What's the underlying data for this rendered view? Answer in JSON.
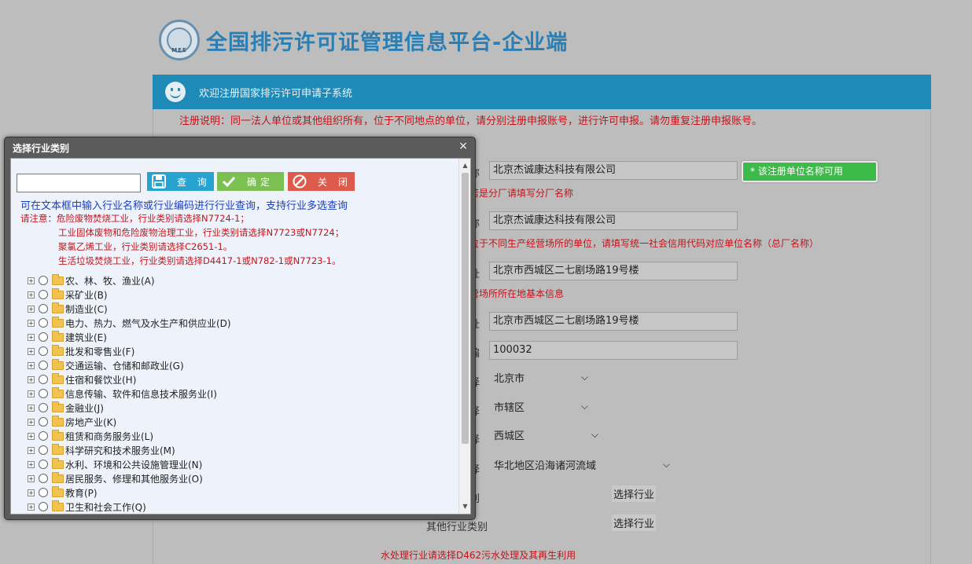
{
  "header": {
    "title": "全国排污许可证管理信息平台-企业端",
    "logo_text": "MEE"
  },
  "banner": {
    "text": "欢迎注册国家排污许可申请子系统"
  },
  "registration_note": "注册说明：同一法人单位或其他组织所有，位于不同地点的单位，请分别注册申报账号，进行许可申报。请勿重复注册申报账号。",
  "form": {
    "unit_name": {
      "label_tail": "称",
      "value": "北京杰诚康达科技有限公司",
      "hint": "若是分厂请填写分厂名称",
      "badge": "* 该注册单位名称可用"
    },
    "parent_name": {
      "label_tail": "称",
      "value": "北京杰诚康达科技有限公司",
      "hint": "位于不同生产经营场所的单位，请填写统一社会信用代码对应单位名称（总厂名称）"
    },
    "site_address": {
      "label_tail": "址",
      "value": "北京市西城区二七剧场路19号楼",
      "hint": "营场所所在地基本信息"
    },
    "office_address": {
      "label_tail": "址",
      "value": "北京市西城区二七剧场路19号楼"
    },
    "postcode": {
      "label_tail": "编",
      "value": "100032"
    },
    "province": {
      "label_tail": "择",
      "value": "北京市"
    },
    "city": {
      "label_tail": "择",
      "value": "市辖区"
    },
    "district": {
      "label_tail": "择",
      "value": "西城区"
    },
    "basin": {
      "label_tail": "择",
      "value": "华北地区沿海诸河流域"
    },
    "industry": {
      "label_tail": "别",
      "button": "选择行业"
    },
    "other_industry": {
      "label": "其他行业类别",
      "button": "选择行业"
    },
    "bottom_note": "水处理行业请选择D462污水处理及其再生利用"
  },
  "dialog": {
    "title": "选择行业类别",
    "close_glyph": "×",
    "search_value": "",
    "buttons": {
      "query": "查 询",
      "ok": "确定",
      "close": "关 闭"
    },
    "info": "可在文本框中输入行业名称或行业编码进行行业查询，支持行业多选查询",
    "notes": [
      "请注意：危险废物焚烧工业，行业类别请选择N7724-1；",
      "工业固体废物和危险废物治理工业，行业类别请选择N7723或N7724；",
      "聚氯乙烯工业，行业类别请选择C2651-1。",
      "生活垃圾焚烧工业，行业类别请选择D4417-1或N782-1或N7723-1。"
    ],
    "tree": [
      "农、林、牧、渔业(A)",
      "采矿业(B)",
      "制造业(C)",
      "电力、热力、燃气及水生产和供应业(D)",
      "建筑业(E)",
      "批发和零售业(F)",
      "交通运输、仓储和邮政业(G)",
      "住宿和餐饮业(H)",
      "信息传输、软件和信息技术服务业(I)",
      "金融业(J)",
      "房地产业(K)",
      "租赁和商务服务业(L)",
      "科学研究和技术服务业(M)",
      "水利、环境和公共设施管理业(N)",
      "居民服务、修理和其他服务业(O)",
      "教育(P)",
      "卫生和社会工作(Q)"
    ]
  }
}
